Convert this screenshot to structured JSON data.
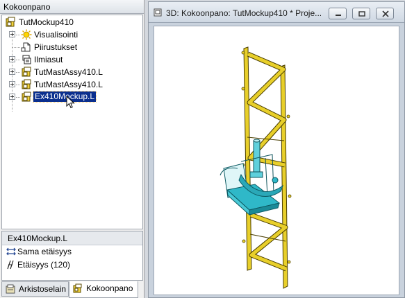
{
  "left_panel": {
    "header": "Kokoonpano",
    "tree": {
      "root": "TutMockup410",
      "items": [
        {
          "label": "Visualisointi",
          "icon": "lightbulb-icon"
        },
        {
          "label": "Piirustukset",
          "icon": "drawing-icon"
        },
        {
          "label": "Ilmiasut",
          "icon": "layers-icon"
        },
        {
          "label": "TutMastAssy410.L",
          "icon": "assembly-icon"
        },
        {
          "label": "TutMastAssy410.L",
          "icon": "assembly-icon"
        },
        {
          "label": "Ex410Mockup.L",
          "icon": "assembly-icon",
          "selected": true
        }
      ]
    },
    "properties": {
      "title": "Ex410Mockup.L",
      "rows": [
        {
          "label": "Sama etäisyys",
          "icon": "equal-spacing-icon"
        },
        {
          "label": "Etäisyys (120)",
          "icon": "distance-icon"
        }
      ]
    },
    "tabs": [
      {
        "label": "Arkistoselain",
        "icon": "archive-icon",
        "active": false
      },
      {
        "label": "Kokoonpano",
        "icon": "assembly-icon",
        "active": true
      }
    ]
  },
  "window_3d": {
    "title": "3D: Kokoonpano: TutMockup410 *  Proje...",
    "buttons": [
      "minimize",
      "restore",
      "close"
    ]
  },
  "colors": {
    "selection": "#0b2f8e",
    "mast_yellow": "#e8cf2a",
    "platform_cyan": "#2fb8c8"
  }
}
